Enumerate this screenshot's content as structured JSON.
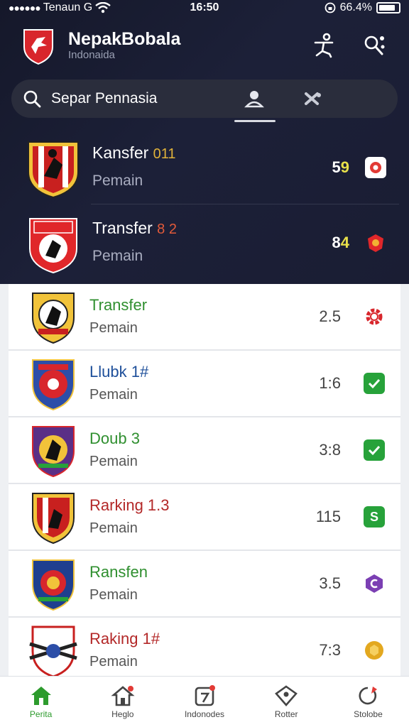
{
  "status_bar": {
    "carrier": "Tenaun G",
    "time": "16:50",
    "battery": "66.4%"
  },
  "header": {
    "title": "NepakBobala",
    "subtitle": "Indonaida"
  },
  "search": {
    "text": "Separ Pennasia"
  },
  "featured": [
    {
      "title": "Kansfer",
      "accent": "011",
      "sub": "Pemain",
      "score": "5",
      "score_hl": "9",
      "status_color": "#e23a35"
    },
    {
      "title": "Transfer",
      "accent": "8 2",
      "sub": "Pemain",
      "score": "8",
      "score_hl": "4",
      "status_color": "#d63a2c"
    }
  ],
  "list": [
    {
      "title": "Transfer",
      "title_color": "#2f8f2f",
      "sub": "Pemain",
      "score": "2.5",
      "icon": "gear-icon",
      "status_color": "#d8262c"
    },
    {
      "title": "Llubk 1#",
      "title_color": "#2f8f2f",
      "sub": "Pemain",
      "score": "1:6",
      "icon": "check-icon",
      "status_color": "#27a23a"
    },
    {
      "title": "Doub 3",
      "title_color": "#2f8f2f",
      "sub": "Pemain",
      "score": "3:8",
      "icon": "check-icon",
      "status_color": "#27a23a"
    },
    {
      "title": "Rarking 1.3",
      "title_color": "#b32828",
      "sub": "Pemain",
      "score": "115",
      "icon": "s-icon",
      "status_color": "#27a23a"
    },
    {
      "title": "Ransfen",
      "title_color": "#2f8f2f",
      "sub": "Pemain",
      "score": "3.5",
      "icon": "hexagon-icon",
      "status_color": "#7b3fb3"
    },
    {
      "title": "Raking 1#",
      "title_color": "#b32828",
      "sub": "Pemain",
      "score": "7:3",
      "icon": "badge-icon",
      "status_color": "#e3a81f"
    }
  ],
  "nav": [
    {
      "label": "Perita",
      "icon": "home-icon",
      "active": true
    },
    {
      "label": "Heglo",
      "icon": "house-alert-icon"
    },
    {
      "label": "Indonodes",
      "icon": "ticket-icon"
    },
    {
      "label": "Rotter",
      "icon": "shield-icon"
    },
    {
      "label": "Stolobe",
      "icon": "pin-icon"
    }
  ],
  "colors": {
    "header_bg": "#1c2038",
    "accent_green": "#2d9b2d",
    "accent_red": "#e23a35"
  }
}
